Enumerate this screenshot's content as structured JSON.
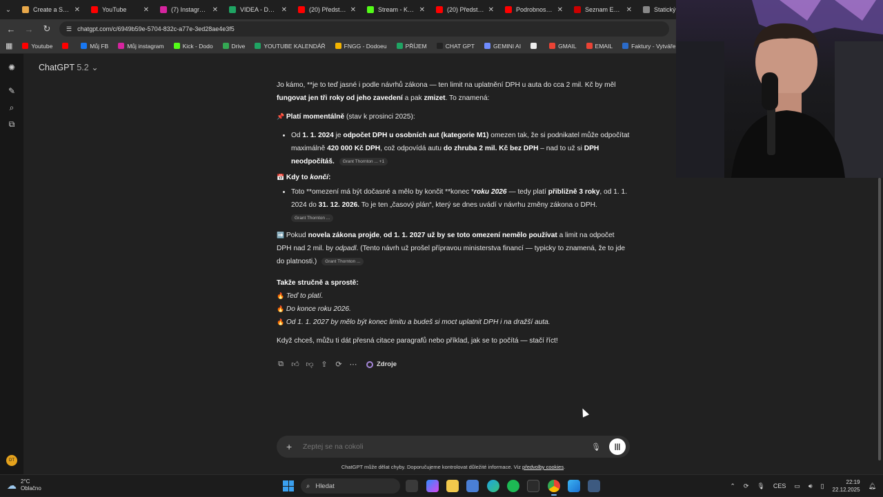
{
  "tabs": [
    {
      "title": "Create a Single",
      "color": "#e8a84a"
    },
    {
      "title": "YouTube",
      "color": "#ff0000"
    },
    {
      "title": "(7) Instagram -",
      "color": "#d6249f"
    },
    {
      "title": "VIDEA - DODO",
      "color": "#1fa463"
    },
    {
      "title": "(20) Předstírám",
      "color": "#ff0000"
    },
    {
      "title": "Stream - Kick D",
      "color": "#53fc18"
    },
    {
      "title": "(20) Předstírám",
      "color": "#ff0000"
    },
    {
      "title": "Podrobnosti o",
      "color": "#ff0000"
    },
    {
      "title": "Seznam Email",
      "color": "#cc0000"
    },
    {
      "title": "Statický",
      "color": "#888888"
    }
  ],
  "address": {
    "url": "chatgpt.com/c/6949b59e-5704-832c-a77e-3ed28ae4e3f5"
  },
  "bookmarks": [
    {
      "label": "Youtube",
      "color": "#ff0000"
    },
    {
      "label": "",
      "color": "#ff0000"
    },
    {
      "label": "Můj FB",
      "color": "#1877f2"
    },
    {
      "label": "Můj instagram",
      "color": "#d6249f"
    },
    {
      "label": "Kick - Dodo",
      "color": "#53fc18"
    },
    {
      "label": "Drive",
      "color": "#34a853"
    },
    {
      "label": "YOUTUBE KALENDÁŘ",
      "color": "#1fa463"
    },
    {
      "label": "FNGG - Dodoeu",
      "color": "#f4b400"
    },
    {
      "label": "PŘÍJEM",
      "color": "#1fa463"
    },
    {
      "label": "CHAT GPT",
      "color": "#222222"
    },
    {
      "label": "GEMINI AI",
      "color": "#6f8cff"
    },
    {
      "label": "",
      "color": "#eeeeee"
    },
    {
      "label": "GMAIL",
      "color": "#ea4335"
    },
    {
      "label": "EMAIL",
      "color": "#ea4335"
    },
    {
      "label": "Faktury - Vytváření",
      "color": "#2b6bc9"
    },
    {
      "label": "PNG to PDF",
      "color": "#e0312f"
    }
  ],
  "sidebar": {
    "model_name": "ChatGPT",
    "model_version": "5.2",
    "avatar_initials": "DT"
  },
  "message": {
    "intro_1": "Jo kámo, **je to teď jasné i podle návrhů zákona — ten limit na uplatnění DPH u auta do cca 2 mil. Kč by měl ",
    "intro_2": "fungovat jen tři roky od jeho zavedení",
    "intro_3": " a pak ",
    "intro_4": "zmizet",
    "intro_5": ". To znamená:",
    "plati_emoji": "📌",
    "plati_title": "Platí momentálně",
    "plati_rest": " (stav k prosinci 2025):",
    "b1_1": "Od ",
    "b1_2": "1. 1. 2024",
    "b1_3": " je ",
    "b1_4": "odpočet DPH u osobních aut (kategorie M1)",
    "b1_5": " omezen tak, že si podnikatel může odpočítat maximálně ",
    "b1_6": "420 000 Kč DPH",
    "b1_7": ", což odpovídá autu ",
    "b1_8": "do zhruba 2 mil. Kč bez DPH",
    "b1_9": " – nad to už si ",
    "b1_10": "DPH neodpočítáš.",
    "b1_chip": "Grant Thornton ... +1",
    "kdy_emoji": "📅",
    "kdy_title": "Kdy to ",
    "kdy_italic": "končí",
    "kdy_colon": ":",
    "b2_1": "Toto **omezení má být dočasné a mělo by končit **konec *",
    "b2_2": "roku 2026",
    "b2_3": " — tedy platí ",
    "b2_4": "přibližně 3 roky",
    "b2_5": ", od 1. 1. 2024 do ",
    "b2_6": "31. 12. 2026.",
    "b2_7": " To je ten „časový plán“, který se dnes uvádí v návrhu změny zákona o DPH.",
    "b2_chip": "Grant Thornton ...",
    "p3_emoji": "➡️",
    "p3_1": " Pokud ",
    "p3_2": "novela zákona projde",
    "p3_3": ", ",
    "p3_4": "od 1. 1. 2027 už by se toto omezení nemělo používat",
    "p3_5": " a limit na odpočet DPH nad 2 mil. by ",
    "p3_6": "odpadl",
    "p3_7": ". (Tento návrh už prošel přípravou ministerstva financí — typicky to znamená, že to jde do platnosti.)",
    "p3_chip": "Grant Thornton ...",
    "summary_title": "Takže stručně a sprostě:",
    "summary_emoji": "🔥",
    "s1": "Teď to platí.",
    "s2": "Do konce roku 2026.",
    "s3": "Od 1. 1. 2027 by mělo být konec limitu a budeš si moct uplatnit DPH i na dražší auta.",
    "closing": "Když chceš, můžu ti dát přesná citace paragrafů nebo příklad, jak se to počítá — stačí říct!"
  },
  "actions": {
    "sources_label": "Zdroje"
  },
  "composer": {
    "placeholder": "Zeptej se na cokoli"
  },
  "disclaimer": {
    "text": "ChatGPT může dělat chyby. Doporučujeme kontrolovat důležité informace. Viz ",
    "link": "předvolby cookies",
    "end": "."
  },
  "taskbar": {
    "temperature": "2°C",
    "condition": "Oblačno",
    "search_label": "Hledat",
    "language": "CES",
    "time": "22:19",
    "date": "22.12.2025"
  }
}
